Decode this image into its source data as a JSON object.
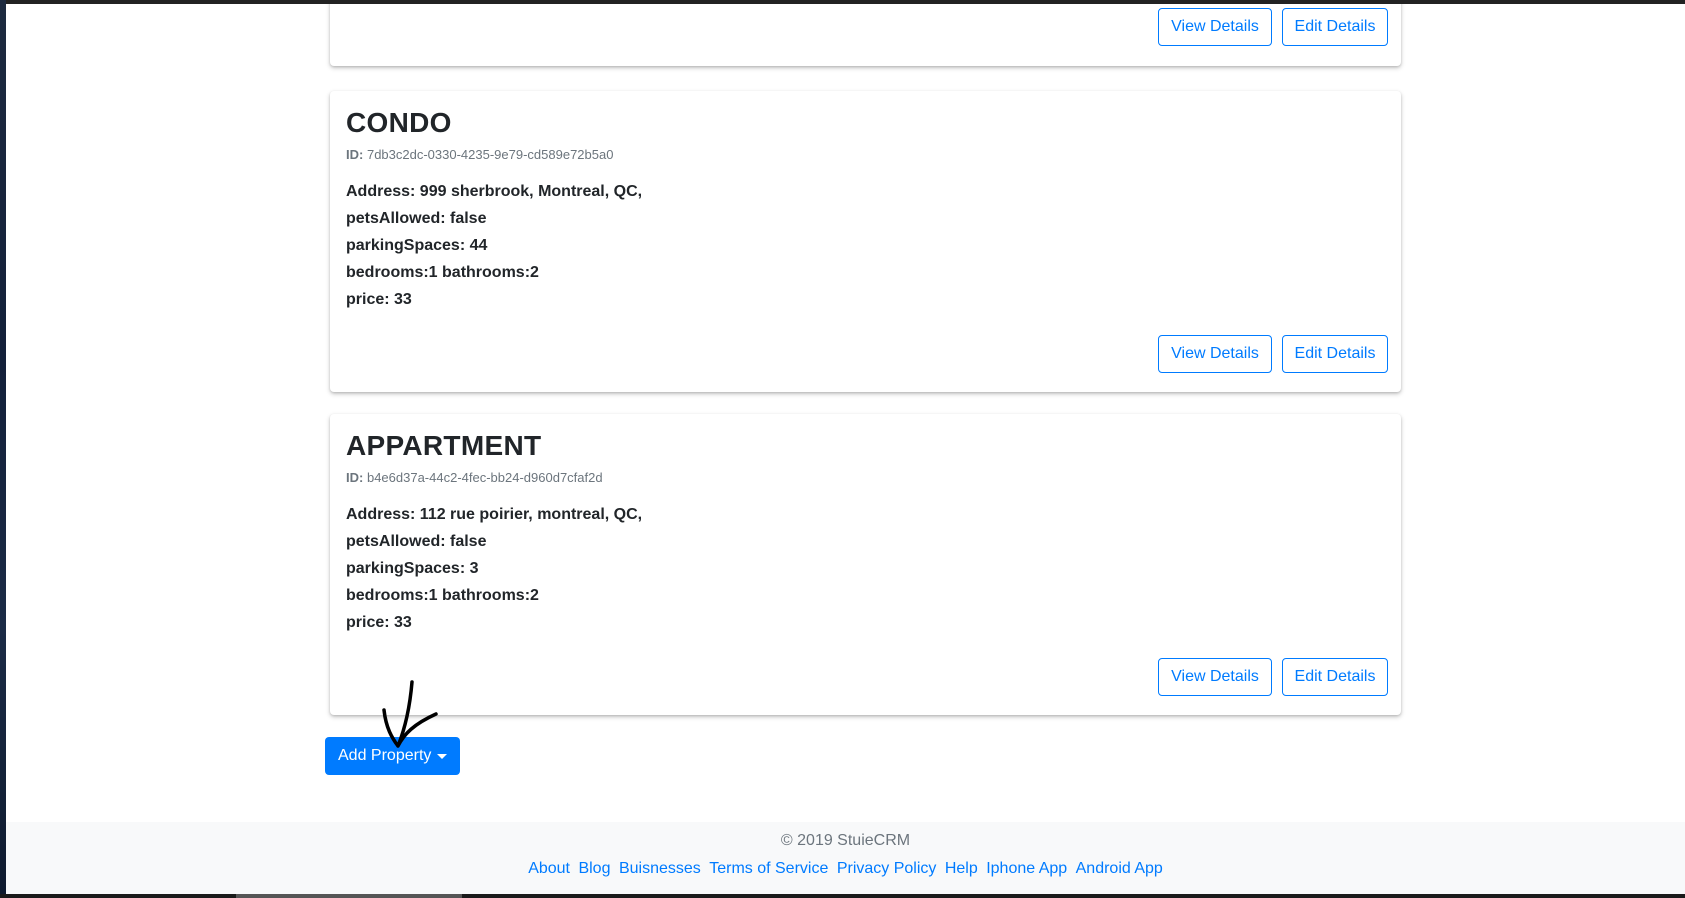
{
  "properties": [
    {
      "title": "",
      "buttons": {
        "view": "View Details",
        "edit": "Edit Details"
      }
    },
    {
      "title": "CONDO",
      "id_label": "ID:",
      "id": "7db3c2dc-0330-4235-9e79-cd589e72b5a0",
      "address": "Address: 999 sherbrook, Montreal, QC,",
      "pets": "petsAllowed: false",
      "parking": "parkingSpaces: 44",
      "rooms": "bedrooms:1 bathrooms:2",
      "price": "price: 33",
      "buttons": {
        "view": "View Details",
        "edit": "Edit Details"
      }
    },
    {
      "title": "APPARTMENT",
      "id_label": "ID:",
      "id": "b4e6d37a-44c2-4fec-bb24-d960d7cfaf2d",
      "address": "Address: 112 rue poirier, montreal, QC,",
      "pets": "petsAllowed: false",
      "parking": "parkingSpaces: 3",
      "rooms": "bedrooms:1 bathrooms:2",
      "price": "price: 33",
      "buttons": {
        "view": "View Details",
        "edit": "Edit Details"
      }
    }
  ],
  "add_property": {
    "label": "Add Property",
    "icon": "caret-down-icon"
  },
  "footer": {
    "copyright": "© 2019 StuieCRM",
    "links": [
      "About",
      "Blog",
      "Buisnesses",
      "Terms of Service",
      "Privacy Policy",
      "Help",
      "Iphone App",
      "Android App"
    ]
  },
  "colors": {
    "primary": "#007bff",
    "text": "#212529",
    "muted": "#6c757d",
    "footer_bg": "#f8f9fa"
  }
}
